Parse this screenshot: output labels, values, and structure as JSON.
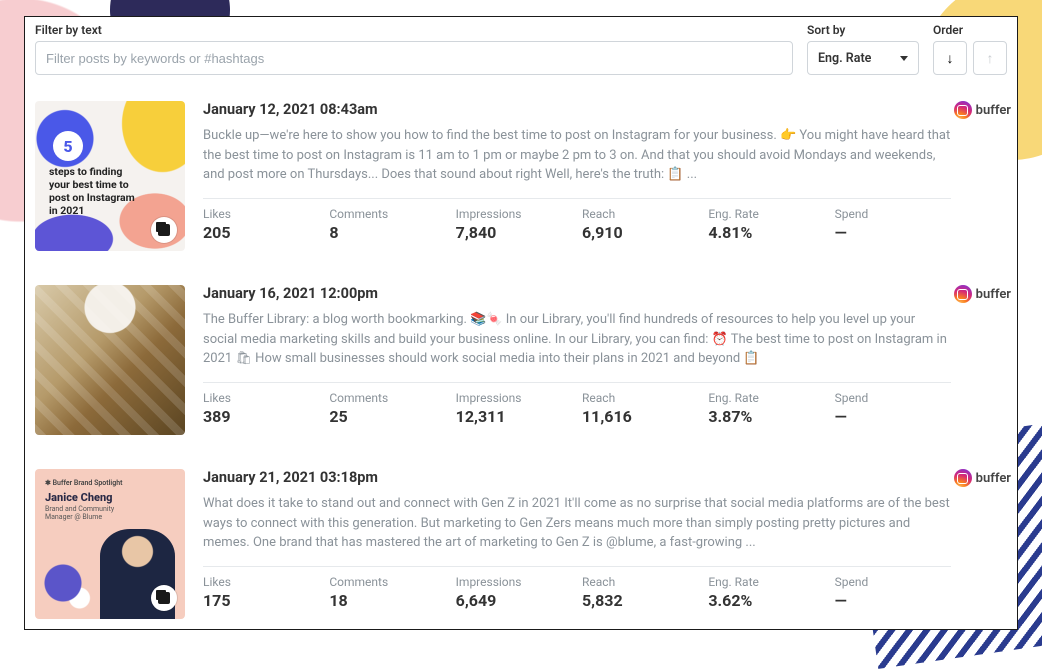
{
  "header": {
    "filter_label": "Filter by text",
    "filter_placeholder": "Filter posts by keywords or #hashtags",
    "sort_label": "Sort by",
    "sort_value": "Eng. Rate",
    "order_label": "Order"
  },
  "brand": {
    "name": "buffer"
  },
  "metric_labels": [
    "Likes",
    "Comments",
    "Impressions",
    "Reach",
    "Eng. Rate",
    "Spend"
  ],
  "posts": [
    {
      "date": "January 12, 2021 08:43am",
      "excerpt": "Buckle up—we're here to show you how to find the best time to post on Instagram for your business. 👉 You might have heard that the best time to post on Instagram is 11 am to 1 pm or maybe 2 pm to 3 on. And that you should avoid Mondays and weekends, and post more on Thursdays... Does that sound about right Well, here's the truth: 📋 ...",
      "thumb": {
        "kind": "svg-5steps",
        "badge_number": "5",
        "caption": "steps to finding your best time to post on Instagram in 2021"
      },
      "metrics": {
        "likes": "205",
        "comments": "8",
        "impressions": "7,840",
        "reach": "6,910",
        "eng_rate": "4.81%",
        "spend": "—"
      }
    },
    {
      "date": "January 16, 2021 12:00pm",
      "excerpt": "The Buffer Library: a blog worth bookmarking. 📚🍬 In our Library, you'll find hundreds of resources to help you level up your social media marketing skills and build your business online. In our Library, you can find: ⏰ The best time to post on Instagram in 2021 🛍 How small businesses should work social media into their plans in 2021 and beyond 📋",
      "thumb": {
        "kind": "photo-books"
      },
      "metrics": {
        "likes": "389",
        "comments": "25",
        "impressions": "12,311",
        "reach": "11,616",
        "eng_rate": "3.87%",
        "spend": "—"
      }
    },
    {
      "date": "January 21, 2021 03:18pm",
      "excerpt": "What does it take to stand out and connect with Gen Z in 2021 It'll come as no surprise that social media platforms are of the best ways to connect with this generation. But marketing to Gen Zers means much more than simply posting pretty pictures and memes. One brand that has mastered the art of marketing to Gen Z is @blume, a fast-growing ...",
      "thumb": {
        "kind": "svg-spotlight",
        "topline": "✱ Buffer Brand Spotlight",
        "name": "Janice Cheng",
        "role": "Brand and Community Manager @ Blume"
      },
      "metrics": {
        "likes": "175",
        "comments": "18",
        "impressions": "6,649",
        "reach": "5,832",
        "eng_rate": "3.62%",
        "spend": "—"
      }
    }
  ]
}
